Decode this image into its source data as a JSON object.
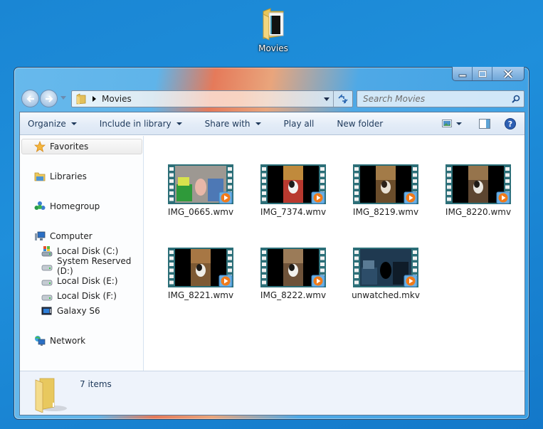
{
  "desktop": {
    "icons": [
      {
        "label": "Movies",
        "icon": "movies-folder-icon"
      }
    ]
  },
  "window": {
    "controls": {
      "minimize": "minimize",
      "maximize": "maximize",
      "close": "close"
    },
    "address_bar": {
      "breadcrumb": [
        "Movies"
      ],
      "search_placeholder": "Search Movies"
    },
    "command_bar": {
      "items": [
        {
          "label": "Organize",
          "dropdown": true
        },
        {
          "label": "Include in library",
          "dropdown": true
        },
        {
          "label": "Share with",
          "dropdown": true
        },
        {
          "label": "Play all",
          "dropdown": false
        },
        {
          "label": "New folder",
          "dropdown": false
        }
      ]
    },
    "nav_pane": {
      "favorites": "Favorites",
      "libraries": "Libraries",
      "homegroup": "Homegroup",
      "computer": "Computer",
      "drives": [
        {
          "label": "Local Disk (C:)",
          "icon": "system-drive-icon"
        },
        {
          "label": "System Reserved (D:)",
          "icon": "drive-icon"
        },
        {
          "label": "Local Disk (E:)",
          "icon": "drive-icon"
        },
        {
          "label": "Local Disk (F:)",
          "icon": "drive-icon"
        },
        {
          "label": "Galaxy S6",
          "icon": "portable-device-icon"
        }
      ],
      "network": "Network"
    },
    "files": [
      {
        "name": "IMG_0665.wmv",
        "thumb": "wide",
        "colors": [
          "#9d9892",
          "#2f9a3a",
          "#d7e24d",
          "#4d78b5",
          "#e8b7a8"
        ]
      },
      {
        "name": "IMG_7374.wmv",
        "thumb": "tall",
        "colors": [
          "#b8392f",
          "#c08a3c",
          "#f2f2f2",
          "#1c1c1c"
        ]
      },
      {
        "name": "IMG_8219.wmv",
        "thumb": "tall",
        "colors": [
          "#6b4d2b",
          "#a37b48",
          "#e8e0d4",
          "#2a2018"
        ]
      },
      {
        "name": "IMG_8220.wmv",
        "thumb": "tall",
        "colors": [
          "#5c4530",
          "#96744c",
          "#e9e6e0",
          "#1e1a16"
        ]
      },
      {
        "name": "IMG_8221.wmv",
        "thumb": "tall",
        "colors": [
          "#7e5a34",
          "#a77744",
          "#f0eee8",
          "#1d1a17"
        ]
      },
      {
        "name": "IMG_8222.wmv",
        "thumb": "tall",
        "colors": [
          "#6e5239",
          "#9b7b58",
          "#f2f1ee",
          "#1a1815"
        ]
      },
      {
        "name": "unwatched.mkv",
        "thumb": "wide",
        "colors": [
          "#1f3950",
          "#2d4d69",
          "#5a7a94",
          "#0f1c29"
        ]
      }
    ],
    "status": {
      "item_count": "7 items"
    }
  }
}
